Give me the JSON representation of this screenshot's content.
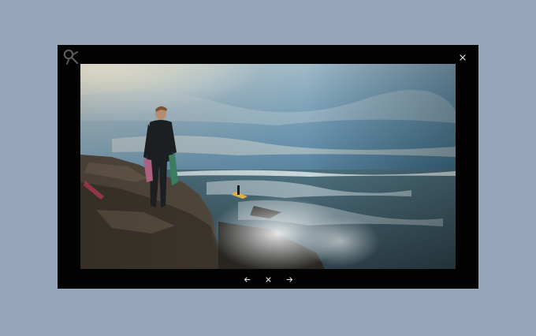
{
  "background_color": "#95a6bb",
  "lightbox": {
    "background_color": "#030303",
    "logo_icon": "brand-logo-icon",
    "close_icon": "close-icon",
    "image": {
      "subject": "surfer-on-rocks"
    },
    "controls": [
      {
        "name": "previous",
        "icon": "arrow-left-icon"
      },
      {
        "name": "close",
        "icon": "close-icon"
      },
      {
        "name": "next",
        "icon": "arrow-right-icon"
      }
    ]
  }
}
